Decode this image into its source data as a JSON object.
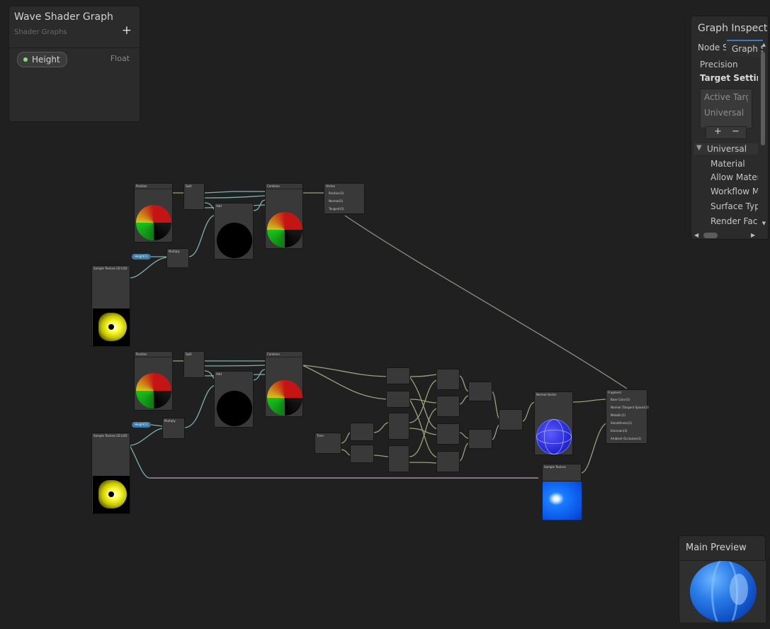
{
  "blackboard": {
    "title": "Wave Shader Graph",
    "subtitle": "Shader Graphs",
    "add_icon": "+",
    "properties": [
      {
        "name": "Height",
        "type": "Float"
      }
    ]
  },
  "inspector": {
    "title": "Graph Inspector",
    "tabs": [
      {
        "label": "Node Settings"
      },
      {
        "label": "Graph Settings"
      }
    ],
    "precision_label": "Precision",
    "target_settings_label": "Target Settings",
    "active_targets_header": "Active Targets",
    "active_target_item": "Universal",
    "list_add": "+",
    "list_remove": "−",
    "universal_foldout": "Universal",
    "universal_items": [
      "Material",
      "Allow Material Override",
      "Workflow Mode",
      "Surface Type",
      "Render Face"
    ]
  },
  "preview": {
    "title": "Main Preview"
  },
  "colors": {
    "background": "#202020",
    "panel": "#2b2b2b",
    "accent_tab": "#3a79bb",
    "property_dot": "#84e07a",
    "wire_vector": "#9aa27a",
    "wire_float": "#7fb0b0",
    "property_pill": "#3a7aa8"
  },
  "graph": {
    "nodes": {
      "position1": "Position",
      "split1": "Split",
      "add1": "Add",
      "combine1": "Combine",
      "vertex": "Vertex",
      "multiply1": "Multiply",
      "sample1": "Sample Texture 2D LOD",
      "position2": "Position",
      "split2": "Split",
      "add2": "Add",
      "combine2": "Combine",
      "multiply2": "Multiply",
      "sample2": "Sample Texture 2D LOD",
      "fragment": "Fragment",
      "sample3": "Sample Texture",
      "normal_vector": "Normal Vector",
      "time": "Time"
    },
    "vertex_ports": [
      "Position(3)",
      "Normal(3)",
      "Tangent(3)"
    ],
    "fragment_ports": [
      "Base Color(3)",
      "Normal (Tangent Space)(3)",
      "Metallic(1)",
      "Smoothness(1)",
      "Emission(3)",
      "Ambient Occlusion(1)"
    ],
    "pills": [
      "Height(1)",
      "Height(1)"
    ]
  }
}
